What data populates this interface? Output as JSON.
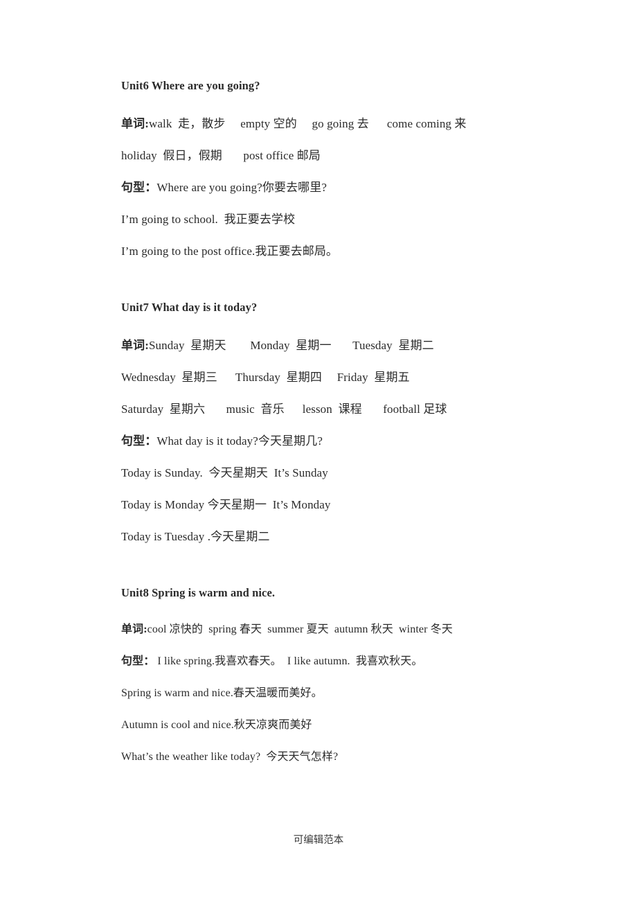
{
  "document": {
    "footer": "可编辑范本"
  },
  "units": [
    {
      "id": "unit6",
      "heading": "Unit6 Where are you going?",
      "vocab_label": "单词:",
      "vocab_lines": [
        "walk  走，散步     empty 空的     go going 去      come coming 来",
        "holiday  假日，假期       post office 邮局"
      ],
      "pattern_label": "句型：",
      "pattern_first": "Where are you going?你要去哪里?",
      "pattern_lines": [
        "I’m going to school.  我正要去学校",
        "I’m going to the post office.我正要去邮局。"
      ]
    },
    {
      "id": "unit7",
      "heading": "Unit7 What day is it today?",
      "vocab_label": "单词:",
      "vocab_lines": [
        "Sunday  星期天        Monday  星期一       Tuesday  星期二",
        "Wednesday  星期三      Thursday  星期四     Friday  星期五",
        "Saturday  星期六       music  音乐      lesson  课程       football 足球"
      ],
      "pattern_label": "句型：",
      "pattern_first": "What day is it today?今天星期几?",
      "pattern_lines": [
        "Today is Sunday.  今天星期天  It’s Sunday",
        "Today is Monday 今天星期一  It’s Monday",
        "Today is Tuesday .今天星期二"
      ]
    },
    {
      "id": "unit8",
      "heading": "Unit8 Spring is warm and nice.",
      "vocab_label": "单词:",
      "vocab_lines": [
        "cool 凉快的  spring 春天  summer 夏天  autumn 秋天  winter 冬天"
      ],
      "pattern_label": "句型：",
      "pattern_first": " I like spring.我喜欢春天。  I like autumn.  我喜欢秋天。",
      "pattern_lines": [
        "Spring is warm and nice.春天温暖而美好。",
        "Autumn is cool and nice.秋天凉爽而美好",
        "What’s the weather like today?  今天天气怎样?"
      ]
    }
  ]
}
